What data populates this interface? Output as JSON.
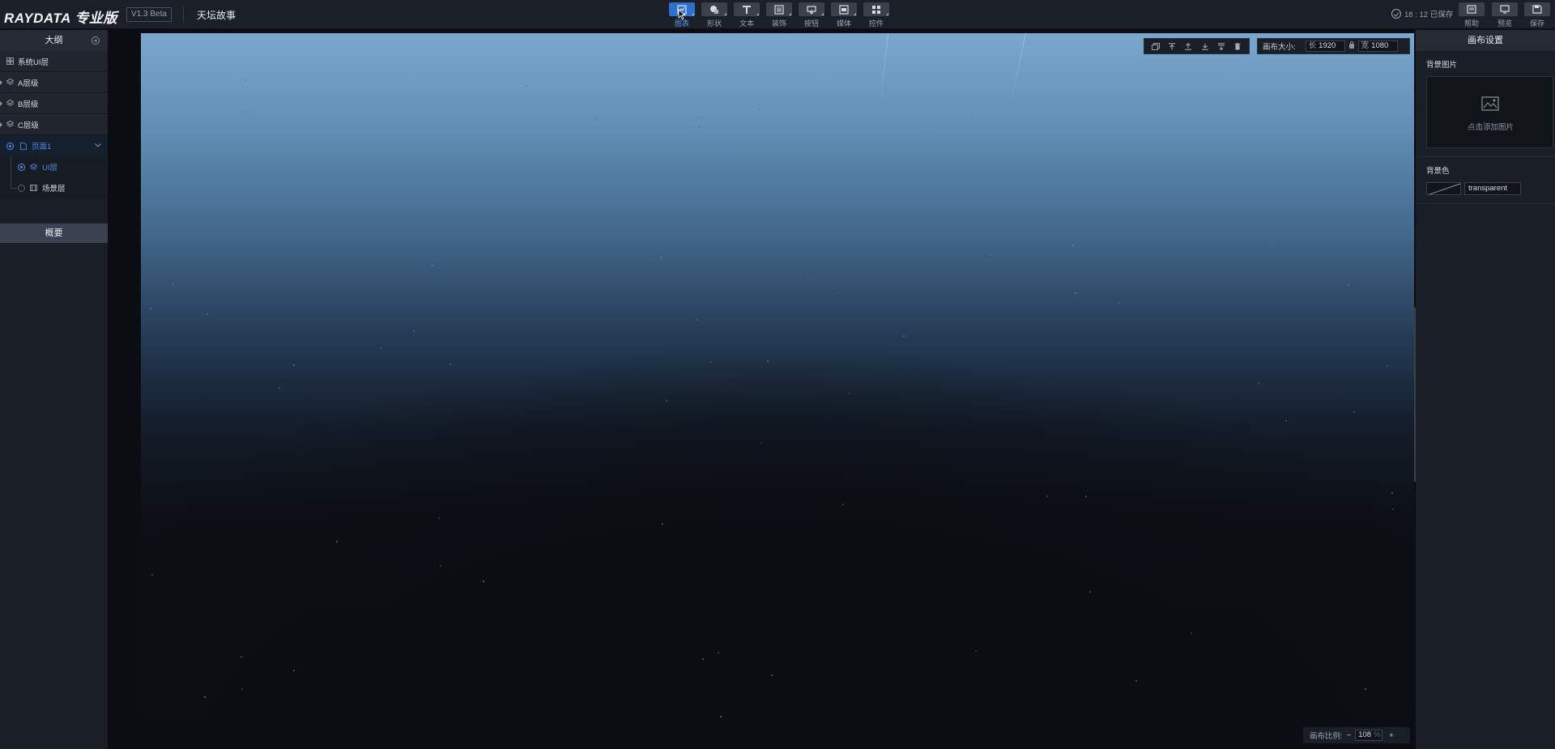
{
  "app": {
    "logo": "RAYDATA 专业版",
    "version": "V1.3 Beta",
    "project_title": "天坛故事"
  },
  "toolbar": {
    "tools": [
      {
        "label": "图表",
        "icon": "chart-icon",
        "active": true
      },
      {
        "label": "形状",
        "icon": "shape-icon",
        "active": false
      },
      {
        "label": "文本",
        "icon": "text-icon",
        "active": false
      },
      {
        "label": "装饰",
        "icon": "decoration-icon",
        "active": false
      },
      {
        "label": "按钮",
        "icon": "button-icon",
        "active": false
      },
      {
        "label": "媒体",
        "icon": "media-icon",
        "active": false
      },
      {
        "label": "控件",
        "icon": "widget-icon",
        "active": false
      }
    ]
  },
  "status": {
    "saved_text": "18 : 12 已保存"
  },
  "actions": {
    "help": "帮助",
    "preview": "预览",
    "save": "保存"
  },
  "outline": {
    "title": "大纲",
    "layers": [
      {
        "label": "系统UI层",
        "icon": "grid-icon",
        "has_caret": false
      },
      {
        "label": "A层级",
        "icon": "layers-icon",
        "has_caret": true
      },
      {
        "label": "B层级",
        "icon": "layers-icon",
        "has_caret": true
      },
      {
        "label": "C层级",
        "icon": "layers-icon",
        "has_caret": true
      }
    ],
    "page": {
      "label": "页面1",
      "expanded": true
    },
    "page_children": [
      {
        "label": "UI层",
        "icon": "layers-icon",
        "selected": true
      },
      {
        "label": "场景层",
        "icon": "film-icon",
        "selected": false
      }
    ],
    "overview_tab": "概要"
  },
  "canvas": {
    "size_label": "画布大小:",
    "length_label": "长",
    "length_value": "1920",
    "width_label": "宽",
    "width_value": "1080",
    "scale_label": "画布比例:",
    "scale_value": "108",
    "scale_unit": "%",
    "minus": "−",
    "plus": "+"
  },
  "settings": {
    "title": "画布设置",
    "bg_image_label": "背景图片",
    "add_image_text": "点击添加图片",
    "bg_color_label": "背景色",
    "bg_color_value": "transparent"
  },
  "colors": {
    "accent": "#2f6fd0",
    "topbar": "#1b1f28",
    "panel": "#1a1e26",
    "sky_top": "#7aa7cd",
    "canvas_dark": "#0b0d12"
  }
}
